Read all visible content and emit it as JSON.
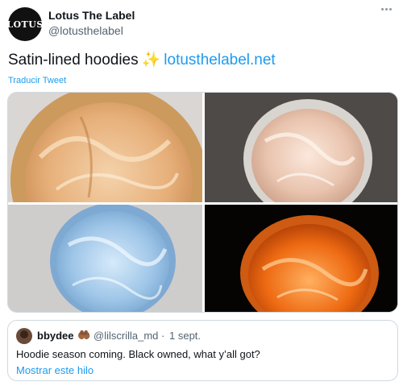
{
  "author": {
    "avatar_text": "LOTUS",
    "name": "Lotus The Label",
    "handle": "@lotusthelabel"
  },
  "tweet": {
    "text": "Satin-lined hoodies",
    "emoji": "✨",
    "link": "lotusthelabel.net",
    "translate_label": "Traducir Tweet"
  },
  "media": {
    "images": [
      {
        "name": "peach satin hood"
      },
      {
        "name": "blush satin hood"
      },
      {
        "name": "baby blue satin hood"
      },
      {
        "name": "orange satin hood"
      }
    ]
  },
  "quote": {
    "name": "bbydee",
    "emoji": "🤲🏾",
    "handle": "@lilscrilla_md",
    "separator": "·",
    "date": "1 sept.",
    "text": "Hoodie season coming. Black owned, what y’all got?",
    "show_thread": "Mostrar este hilo"
  },
  "colors": {
    "accent": "#1d9bf0",
    "text": "#0f1419",
    "secondary": "#536471",
    "border": "#cfd9de"
  }
}
